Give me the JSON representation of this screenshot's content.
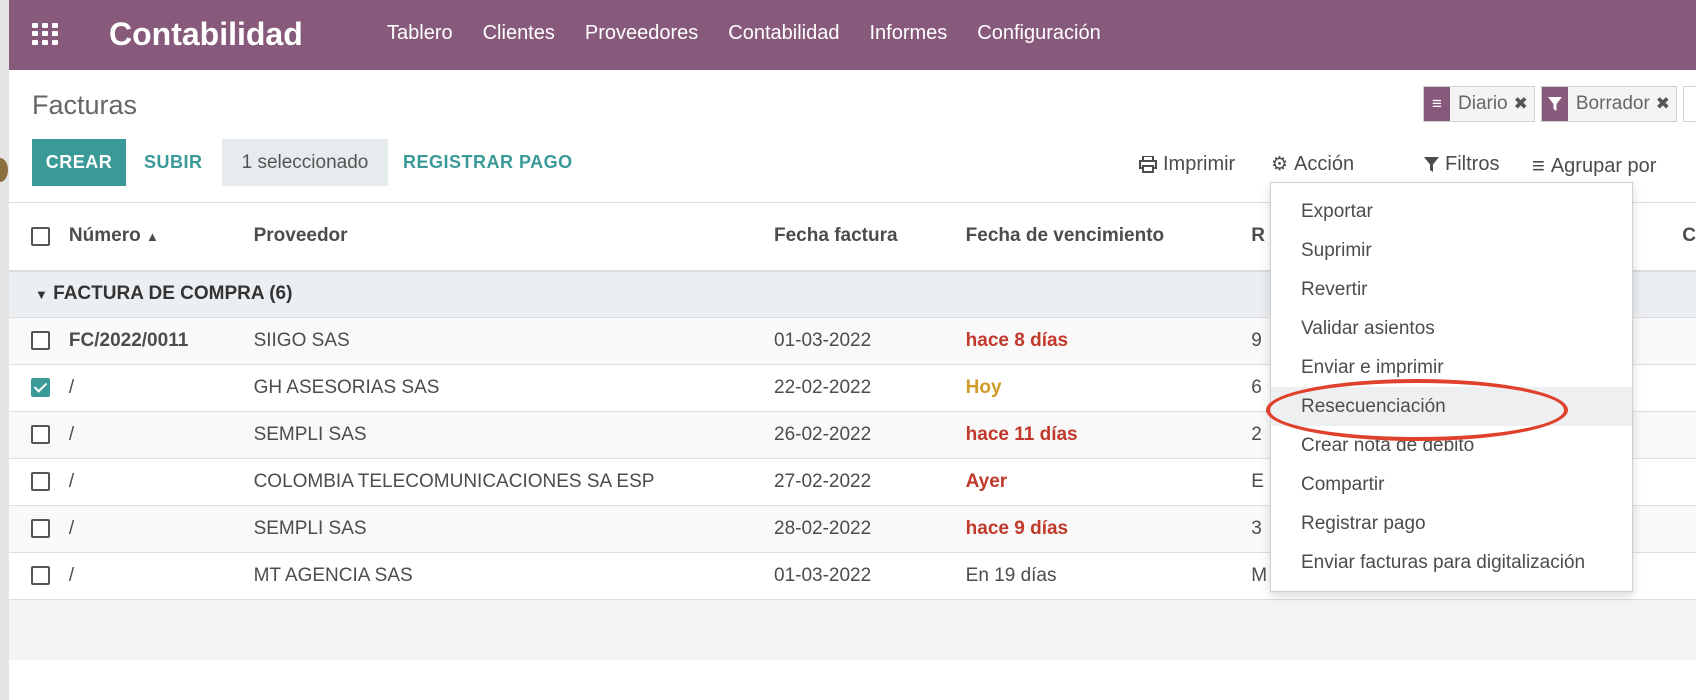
{
  "topbar": {
    "brand": "Contabilidad",
    "menu": [
      "Tablero",
      "Clientes",
      "Proveedores",
      "Contabilidad",
      "Informes",
      "Configuración"
    ]
  },
  "control": {
    "title": "Facturas",
    "facets": [
      {
        "label": "Diario",
        "icon": "list-icon"
      },
      {
        "label": "Borrador",
        "icon": "filter-icon"
      }
    ],
    "buttons": {
      "create": "CREAR",
      "upload": "SUBIR",
      "selected": "1 seleccionado",
      "register_payment": "REGISTRAR PAGO"
    },
    "tools": {
      "print": "Imprimir",
      "action": "Acción",
      "filters": "Filtros",
      "group_by": "Agrupar por"
    }
  },
  "table": {
    "headers": {
      "number": "Número",
      "supplier": "Proveedor",
      "invoice_date": "Fecha factura",
      "due_date": "Fecha de vencimiento",
      "next_partial": "R",
      "last_partial": "C"
    },
    "group_label": "FACTURA DE COMPRA (6)",
    "rows": [
      {
        "number": "FC/2022/0011",
        "supplier": "SIIGO SAS",
        "date": "01-03-2022",
        "due": "hace 8 días",
        "due_style": "red",
        "ref": "9",
        "checked": false
      },
      {
        "number": "/",
        "supplier": "GH ASESORIAS SAS",
        "date": "22-02-2022",
        "due": "Hoy",
        "due_style": "amber",
        "ref": "6",
        "checked": true
      },
      {
        "number": "/",
        "supplier": "SEMPLI SAS",
        "date": "26-02-2022",
        "due": "hace 11 días",
        "due_style": "red",
        "ref": "2",
        "checked": false
      },
      {
        "number": "/",
        "supplier": "COLOMBIA TELECOMUNICACIONES SA ESP",
        "date": "27-02-2022",
        "due": "Ayer",
        "due_style": "red",
        "ref": "E",
        "checked": false
      },
      {
        "number": "/",
        "supplier": "SEMPLI SAS",
        "date": "28-02-2022",
        "due": "hace 9 días",
        "due_style": "red",
        "ref": "3",
        "checked": false
      },
      {
        "number": "/",
        "supplier": "MT AGENCIA SAS",
        "date": "01-03-2022",
        "due": "En 19 días",
        "due_style": "normal",
        "ref": "M",
        "checked": false
      }
    ]
  },
  "action_menu": {
    "items": [
      "Exportar",
      "Suprimir",
      "Revertir",
      "Validar asientos",
      "Enviar e imprimir",
      "Resecuenciación",
      "Crear nota de débito",
      "Compartir",
      "Registrar pago",
      "Enviar facturas para digitalización"
    ],
    "highlighted": "Resecuenciación"
  },
  "colors": {
    "brand": "#875a7b",
    "primary": "#3a9a98",
    "danger": "#c0392b",
    "warning": "#d09a2a",
    "annotation": "#e0412c"
  }
}
